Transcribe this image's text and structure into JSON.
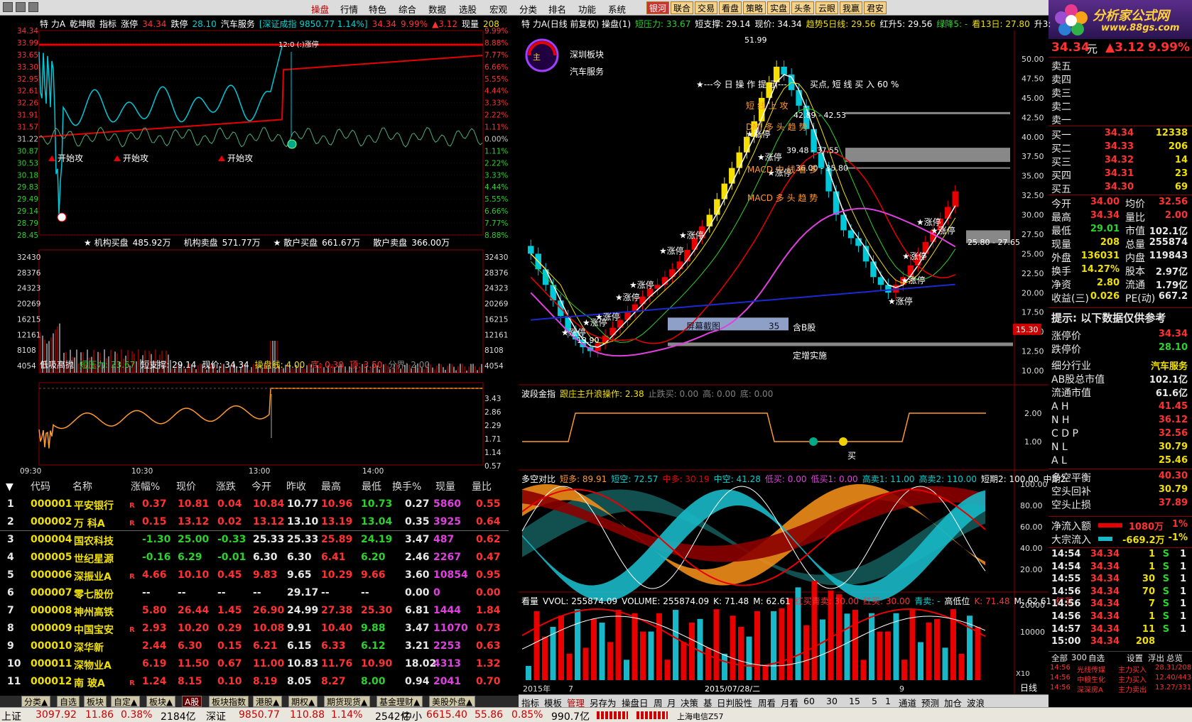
{
  "menu": {
    "items": [
      "操盘",
      "行情",
      "特色",
      "综合",
      "数据",
      "选股",
      "宏观",
      "分类",
      "排名",
      "功能",
      "系统"
    ],
    "active": "操盘",
    "buttons": [
      "银河",
      "联合",
      "交易",
      "看盘",
      "策略",
      "实盘",
      "头条",
      "云眼",
      "我赢",
      "君安"
    ]
  },
  "logo": {
    "line1": "分析家公式网",
    "line2": "www.88gs.com"
  },
  "intraday": {
    "header": [
      "特 力A",
      "乾坤眼",
      "指标",
      "涨停",
      "34.34",
      "跌停",
      "28.10",
      "汽车服务",
      "[深证成指 9850.77 1.14%]",
      "34.34",
      "9.99%",
      "▲3.12",
      "现量",
      "208"
    ],
    "price_left": [
      "34.34",
      "33.99",
      "33.65",
      "33.30",
      "32.95",
      "32.61",
      "32.26",
      "31.91",
      "31.57",
      "31.22",
      "30.87",
      "30.53",
      "30.18",
      "29.83",
      "29.49",
      "29.14",
      "28.79",
      "28.45"
    ],
    "pct_right": [
      "9.99%",
      "8.88%",
      "7.77%",
      "6.66%",
      "5.55%",
      "4.44%",
      "3.33%",
      "2.22%",
      "1.11%",
      "0.00%",
      "1.11%",
      "2.22%",
      "3.33%",
      "4.44%",
      "5.55%",
      "6.66%",
      "7.77%",
      "8.88%"
    ],
    "annotations": [
      "开始攻",
      "开始攻",
      "开始攻",
      "12:0 (:)涨停"
    ],
    "flow": [
      {
        "label": "★ 机构买盘",
        "value": "485.92万"
      },
      {
        "label": "机构卖盘",
        "value": "571.77万"
      },
      {
        "label": "★ 散户买盘",
        "value": "661.67万"
      },
      {
        "label": "散户卖盘",
        "value": "366.00万"
      }
    ],
    "vol_axis": [
      "32430",
      "28376",
      "24323",
      "20269",
      "16215",
      "12161",
      "8108",
      "4054"
    ],
    "sub": {
      "title": "低吸高抛",
      "items": [
        "短压力: 33.67",
        "短支撑: 29.14",
        "现价: 34.34",
        "操盘线: 4.00",
        "底: 0.30",
        "顶: 3.50",
        "分界: 2.00"
      ],
      "axis": [
        "3.43",
        "2.86",
        "2.29",
        "1.71",
        "1.14",
        "0.57"
      ]
    },
    "time_axis": [
      "09:30",
      "10:30",
      "13:00",
      "14:00"
    ]
  },
  "kline": {
    "header": [
      "特 力A(日线 前复权) 操盘(1)",
      "短压力: 33.67",
      "短支撑: 29.14",
      "现价: 34.34",
      "趋势5日线: 29.56",
      "红升5: 29.56",
      "绿降5: -",
      "看13日: 27.80",
      "升3:"
    ],
    "labels": [
      "深圳板块",
      "汽车服务"
    ],
    "notes": [
      "★---今 日 操 作 提 示---",
      "买点, 短 线 买 入 60 %",
      "短 线 上 攻",
      "DMI 多 头 趋 势",
      "MACD 中 线 看 多",
      "MACD 多 头 趋 势"
    ],
    "price_axis": [
      "50.00",
      "47.50",
      "45.00",
      "42.50",
      "40.00",
      "37.50",
      "35.00",
      "32.50",
      "30.00",
      "27.50",
      "25.00",
      "22.50",
      "20.00",
      "17.50",
      "15.00",
      "12.50",
      "10.00"
    ],
    "extra": {
      "high": "51.99",
      "low": "13.90",
      "zone1": "42.89 - 42.53",
      "zone2": "39.48 - 37.55",
      "zone3": "36.00 - 35.80",
      "zone4": "25.80 - 27.65",
      "price_tag": "15.30",
      "screen": "屏幕截图",
      "screen_no": "35",
      "contains": "含B股",
      "fixed": "定增实施"
    },
    "zt": "涨停",
    "wave": {
      "title": "波段金指",
      "items": [
        "跟庄主升浪操作: 2.38",
        "止跌买: 0.00",
        "高: 0.00",
        "底: 0.00"
      ],
      "axis": [
        "2.00",
        "1.00"
      ],
      "buy": "买"
    },
    "dk": {
      "title": "多空对比",
      "items": [
        "短多: 89.91",
        "短空: 72.57",
        "中多: 30.19",
        "中空: 41.28",
        "低买: 0.00",
        "低买1: 0.00",
        "高卖1: 11.00",
        "高卖2: 110.00",
        "短期2: 100.00",
        "中期2:"
      ],
      "axis": [
        "100.00",
        "80.00",
        "60.00",
        "40.00",
        "20.00"
      ]
    },
    "vol": {
      "title": "看量",
      "items": [
        "VVOL: 255874.09",
        "VOLUME: 255874.09",
        "K: 71.48",
        "M: 62.61",
        "红买青卖: 30.00",
        "红买: 30.00",
        "青卖: -",
        "高低位",
        "K: 71.48",
        "M: 62.61",
        "红买"
      ],
      "axis": [
        "20000",
        "10000"
      ],
      "x10": "X10"
    },
    "dates": [
      "2015年",
      "7",
      "2015/07/28/二",
      "9"
    ],
    "toolbar": [
      "指标",
      "模板",
      "管理",
      "另存为",
      "操盘日",
      "周",
      "月",
      "决策",
      "基",
      "日判股性",
      "周看",
      "月看",
      "60",
      "30",
      "15",
      "5",
      "1",
      "通道",
      "预测",
      "加仓",
      "波浪"
    ],
    "rightlabel": "日线"
  },
  "quote": {
    "price": "34.34",
    "unit": "元",
    "change": "▲3.12",
    "pct": "9.99%",
    "asks": [
      "卖五",
      "卖四",
      "卖三",
      "卖二",
      "卖一"
    ],
    "bids": [
      {
        "l": "买一",
        "p": "34.34",
        "v": "12338"
      },
      {
        "l": "买二",
        "p": "34.33",
        "v": "206"
      },
      {
        "l": "买三",
        "p": "34.32",
        "v": "14"
      },
      {
        "l": "买四",
        "p": "34.31",
        "v": "23"
      },
      {
        "l": "买五",
        "p": "34.30",
        "v": "69"
      }
    ],
    "stats": [
      [
        "今开",
        "34.00",
        "均价",
        "32.56"
      ],
      [
        "最高",
        "34.34",
        "量比",
        "2.00"
      ],
      [
        "最低",
        "29.01",
        "市值",
        "102.1亿"
      ],
      [
        "现量",
        "208",
        "总量",
        "255874"
      ],
      [
        "外盘",
        "136031",
        "内盘",
        "119843"
      ],
      [
        "换手",
        "14.27%",
        "股本",
        "2.97亿"
      ],
      [
        "净资",
        "2.80",
        "流通",
        "1.79亿"
      ],
      [
        "收益(三)",
        "0.026",
        "PE(动)",
        "667.2"
      ]
    ],
    "tip": "提示: 以下数据仅供参考",
    "limits": [
      [
        "涨停价",
        "34.34"
      ],
      [
        "跌停价",
        "28.10"
      ]
    ],
    "industry": [
      [
        "细分行业",
        "汽车服务"
      ],
      [
        "AB股总市值",
        "102.1亿"
      ],
      [
        "流通市值",
        "61.6亿"
      ]
    ],
    "idx": [
      [
        "A H",
        "41.45"
      ],
      [
        "N H",
        "36.12"
      ],
      [
        "C D P",
        "32.56"
      ],
      [
        "N L",
        "30.79"
      ],
      [
        "A L",
        "25.46"
      ]
    ],
    "bal": [
      [
        "多空平衡",
        "40.30"
      ],
      [
        "空头回补",
        "30.79"
      ],
      [
        "空头止损",
        "37.89"
      ]
    ],
    "flow": [
      [
        "净流入额",
        "1080万",
        "1%"
      ],
      [
        "大宗流入",
        "-669.2万",
        "-1%"
      ]
    ],
    "ticks": [
      [
        "14:54",
        "34.34",
        "1",
        "S",
        "1"
      ],
      [
        "14:54",
        "34.34",
        "1",
        "S",
        "1"
      ],
      [
        "14:55",
        "34.34",
        "30",
        "S",
        "1"
      ],
      [
        "14:56",
        "34.34",
        "70",
        "S",
        "1"
      ],
      [
        "14:56",
        "34.34",
        "7",
        "S",
        "1"
      ],
      [
        "14:56",
        "34.34",
        "1",
        "S",
        "1"
      ],
      [
        "14:57",
        "34.34",
        "11",
        "S",
        "1"
      ],
      [
        "15:00",
        "34.34",
        "208",
        "",
        ""
      ]
    ],
    "tickbar": [
      "全部",
      "300",
      "自选",
      "设置",
      "浮出",
      "总览"
    ],
    "news": [
      [
        "14:56",
        "光线传媒",
        "主力买入",
        "28.31/2089"
      ],
      [
        "14:56",
        "中粮生化",
        "主力买入",
        "12.40/4438"
      ],
      [
        "14:56",
        "深深房A",
        "主力卖出",
        "13.27/3317"
      ]
    ]
  },
  "table": {
    "headers": [
      "代码",
      "名称",
      "涨幅%",
      "现价",
      "涨跌",
      "今开",
      "昨收",
      "最高",
      "最低",
      "换手%",
      "现量",
      "量比"
    ],
    "rows": [
      [
        "1",
        "000001",
        "平安银行",
        "R",
        "0.37",
        "10.81",
        "0.04",
        "10.84",
        "10.77",
        "10.96",
        "10.73",
        "0.27",
        "5860",
        "0.55"
      ],
      [
        "2",
        "000002",
        "万 科A",
        "R",
        "0.15",
        "13.12",
        "0.02",
        "13.12",
        "13.10",
        "13.19",
        "13.04",
        "0.35",
        "3925",
        "0.64"
      ],
      [
        "3",
        "000004",
        "国农科技",
        "",
        "-1.30",
        "25.00",
        "-0.33",
        "25.33",
        "25.33",
        "25.89",
        "24.19",
        "3.47",
        "487",
        "0.62"
      ],
      [
        "4",
        "000005",
        "世纪星源",
        "",
        "-0.16",
        "6.29",
        "-0.01",
        "6.30",
        "6.30",
        "6.41",
        "6.20",
        "2.46",
        "2267",
        "0.47"
      ],
      [
        "5",
        "000006",
        "深振业A",
        "R",
        "4.66",
        "10.10",
        "0.45",
        "9.83",
        "9.65",
        "10.29",
        "9.66",
        "3.60",
        "10854",
        "0.95"
      ],
      [
        "6",
        "000007",
        "零七股份",
        "",
        "--",
        "--",
        "--",
        "--",
        "29.17",
        "--",
        "--",
        "0.00",
        "0",
        "0.00"
      ],
      [
        "7",
        "000008",
        "神州高铁",
        "",
        "5.80",
        "26.44",
        "1.45",
        "26.90",
        "24.99",
        "27.38",
        "25.30",
        "6.81",
        "1444",
        "1.84"
      ],
      [
        "8",
        "000009",
        "中国宝安",
        "R",
        "2.93",
        "10.20",
        "0.29",
        "10.08",
        "9.91",
        "10.40",
        "9.88",
        "3.47",
        "11070",
        "0.73"
      ],
      [
        "9",
        "000010",
        "深华新",
        "",
        "2.44",
        "6.30",
        "0.15",
        "6.21",
        "6.15",
        "6.33",
        "6.12",
        "3.21",
        "2253",
        "0.63"
      ],
      [
        "10",
        "000011",
        "深物业A",
        "",
        "6.19",
        "11.50",
        "0.67",
        "11.00",
        "10.83",
        "11.76",
        "10.90",
        "18.02",
        "4313",
        "1.32"
      ],
      [
        "11",
        "000012",
        "南 玻A",
        "R",
        "1.24",
        "8.15",
        "0.10",
        "8.19",
        "8.05",
        "8.27",
        "8.00",
        "0.94",
        "2041",
        "0.70"
      ]
    ]
  },
  "tabs": [
    "分类▲",
    "自选",
    "板块",
    "自定▲",
    "板块▲",
    "A股",
    "板块指数",
    "港股▲",
    "期权▲",
    "期货现货▲",
    "基金理财▲",
    "美股外盘▲"
  ],
  "status": {
    "sh": "上证",
    "sh_v": "3097.92",
    "sh_c": "11.86",
    "sh_p": "0.38%",
    "sh_a": "2184亿",
    "sz": "深证",
    "sz_v": "9850.77",
    "sz_c": "110.88",
    "sz_p": "1.14%",
    "sz_a": "2542亿",
    "zx": "中小",
    "zx_v": "6615.40",
    "zx_c": "55.86",
    "zx_p": "0.85%",
    "zx_a": "990.7亿",
    "broker": "上海电信Z57"
  }
}
